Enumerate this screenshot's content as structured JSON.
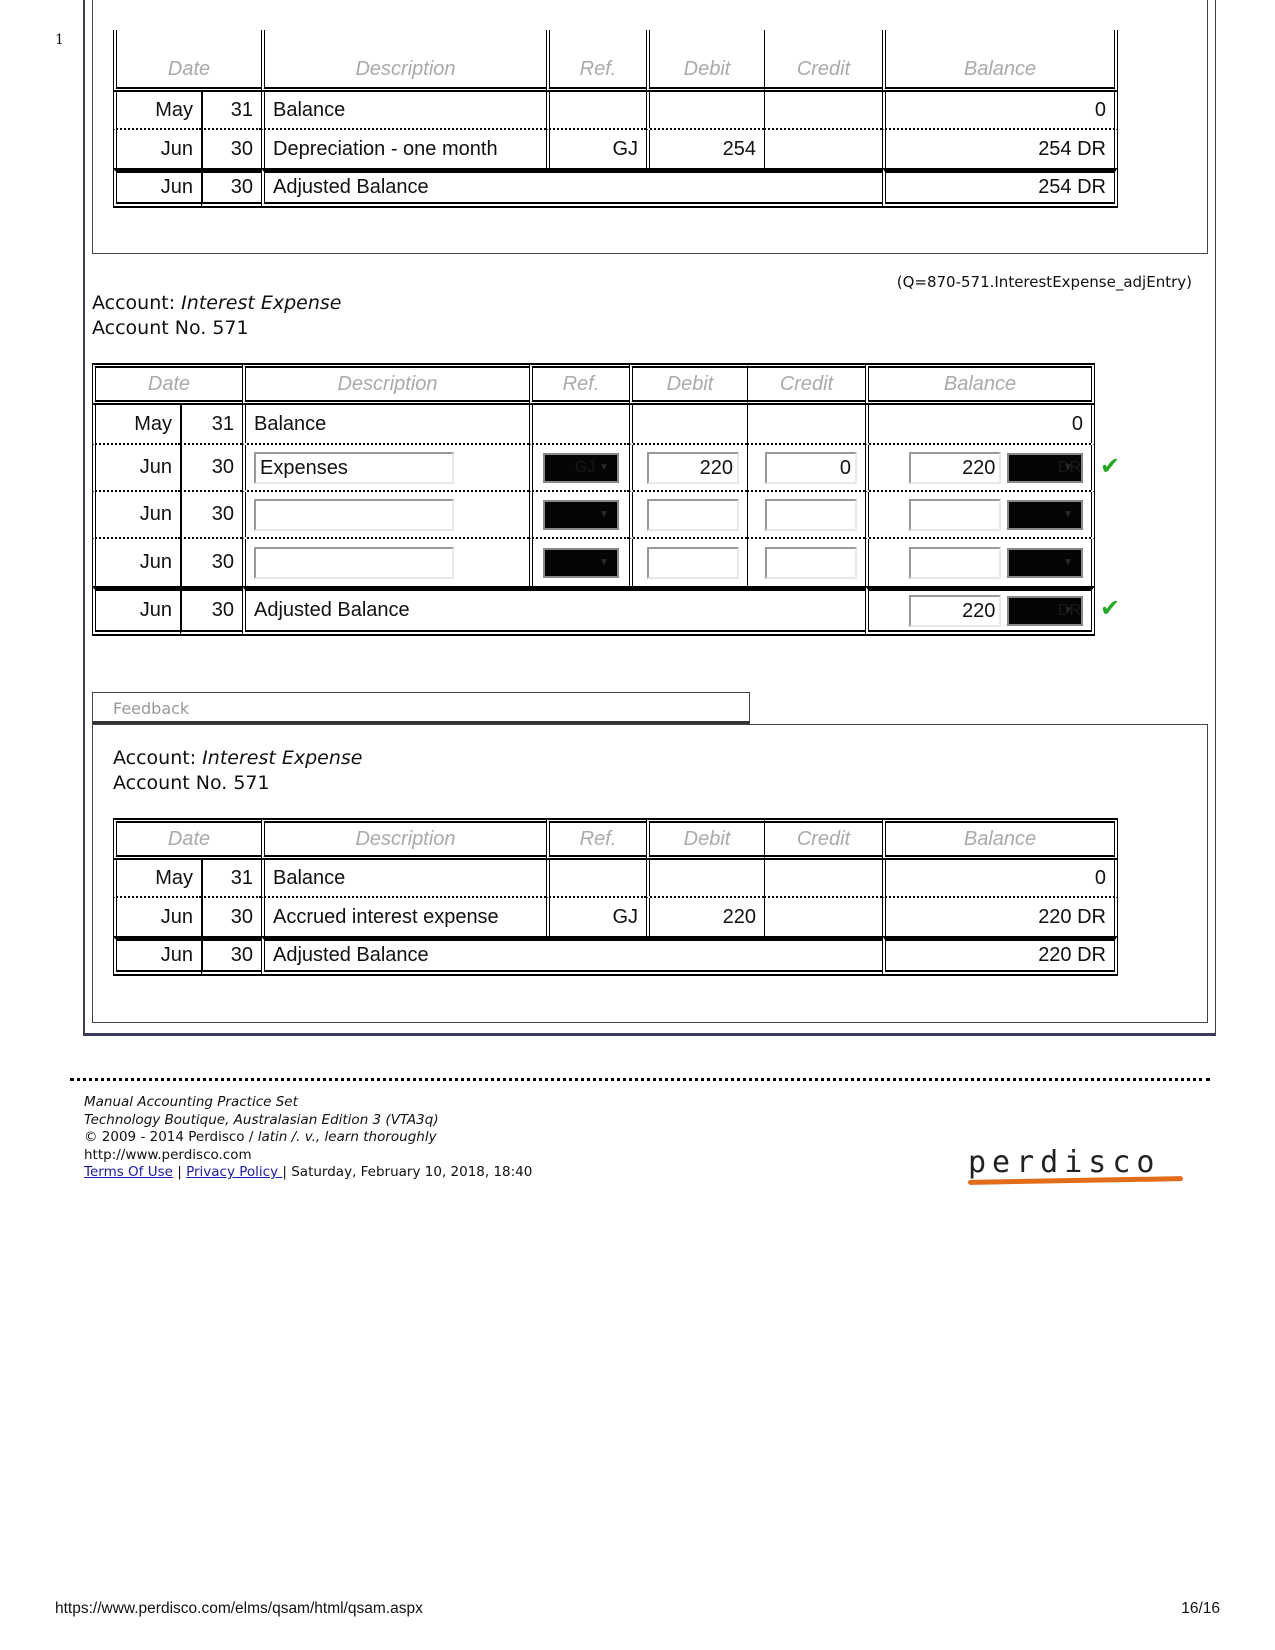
{
  "page_marker": "1",
  "columns": [
    "Date",
    "Description",
    "Ref.",
    "Debit",
    "Credit",
    "Balance"
  ],
  "top_ledger": {
    "rows": [
      {
        "month": "May",
        "day": "31",
        "description": "Balance",
        "ref": "",
        "debit": "",
        "credit": "",
        "balance": "0"
      },
      {
        "month": "Jun",
        "day": "30",
        "description": "Depreciation - one month",
        "ref": "GJ",
        "debit": "254",
        "credit": "",
        "balance": "254 DR"
      }
    ],
    "adjusted": {
      "month": "Jun",
      "day": "30",
      "description": "Adjusted Balance",
      "balance": "254 DR"
    }
  },
  "question_id": "(Q=870-571.InterestExpense_adjEntry)",
  "account": {
    "label": "Account:",
    "name": "Interest Expense",
    "number_label": "Account No. 571"
  },
  "entry_ledger": {
    "opening": {
      "month": "May",
      "day": "31",
      "description": "Balance",
      "balance": "0"
    },
    "rows": [
      {
        "month": "Jun",
        "day": "30",
        "description": "Expenses",
        "ref": "GJ",
        "debit": "220",
        "credit": "0",
        "balance": "220",
        "balance_side": "DR",
        "correct": true
      },
      {
        "month": "Jun",
        "day": "30",
        "description": "",
        "ref": "",
        "debit": "",
        "credit": "",
        "balance": "",
        "balance_side": "",
        "correct": false
      },
      {
        "month": "Jun",
        "day": "30",
        "description": "",
        "ref": "",
        "debit": "",
        "credit": "",
        "balance": "",
        "balance_side": "",
        "correct": false
      }
    ],
    "adjusted": {
      "month": "Jun",
      "day": "30",
      "description": "Adjusted Balance",
      "balance": "220",
      "balance_side": "DR",
      "correct": true
    },
    "check_mark": "✔"
  },
  "feedback": {
    "tab_label": "Feedback",
    "account_label": "Account:",
    "account_name": "Interest Expense",
    "account_number": "Account No. 571",
    "rows": [
      {
        "month": "May",
        "day": "31",
        "description": "Balance",
        "ref": "",
        "debit": "",
        "credit": "",
        "balance": "0"
      },
      {
        "month": "Jun",
        "day": "30",
        "description": "Accrued interest expense",
        "ref": "GJ",
        "debit": "220",
        "credit": "",
        "balance": "220 DR"
      }
    ],
    "adjusted": {
      "month": "Jun",
      "day": "30",
      "description": "Adjusted Balance",
      "balance": "220 DR"
    }
  },
  "footer": {
    "line1": "Manual Accounting Practice Set",
    "line2": "Technology Boutique, Australasian Edition 3 (VTA3q)",
    "copyright": "© 2009 - 2014 Perdisco / ",
    "motto": "latin /. v., learn thoroughly",
    "website": "http://www.perdisco.com",
    "terms_link": "Terms Of Use",
    "separator": "|",
    "privacy_link": "Privacy Policy ",
    "timestamp": "| Saturday, February 10, 2018, 18:40",
    "logo_text": "perdisco",
    "brand_color": "#e36b1c"
  },
  "print_footer": {
    "url": "https://www.perdisco.com/elms/qsam/html/qsam.aspx",
    "page": "16/16"
  }
}
